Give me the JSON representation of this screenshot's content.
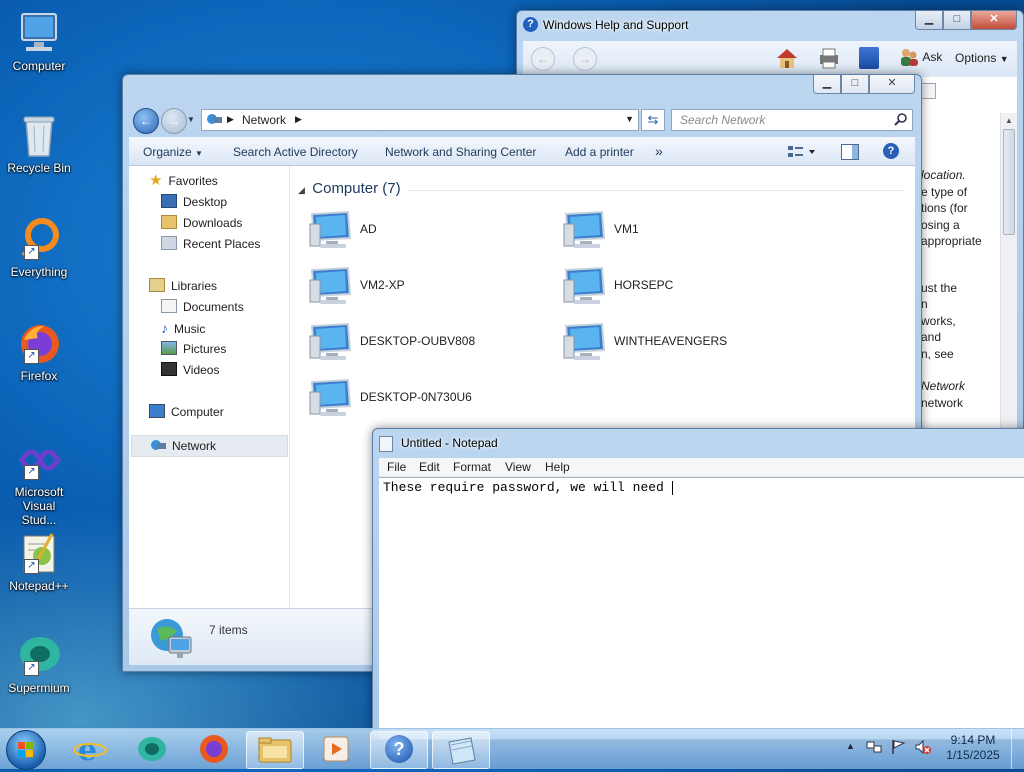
{
  "desktop": {
    "icons": [
      {
        "label": "Computer"
      },
      {
        "label": "Recycle Bin"
      },
      {
        "label": "Everything"
      },
      {
        "label": "Firefox"
      },
      {
        "label": "Microsoft Visual Stud..."
      },
      {
        "label": "Notepad++"
      },
      {
        "label": "Supermium"
      }
    ]
  },
  "help_window": {
    "title": "Windows Help and Support",
    "toolbar": {
      "ask": "Ask",
      "options": "Options"
    },
    "text_lines": [
      "location.",
      "e type of",
      "tions (for",
      "osing a",
      "appropriate",
      "ust the",
      "n",
      "works,",
      "and",
      "n, see",
      "Network",
      "network"
    ]
  },
  "explorer": {
    "address": {
      "location": "Network"
    },
    "search_placeholder": "Search Network",
    "commands": {
      "organize": "Organize",
      "search_ad": "Search Active Directory",
      "network_sharing": "Network and Sharing Center",
      "add_printer": "Add a printer",
      "more": "»"
    },
    "nav": {
      "favorites": "Favorites",
      "desktop": "Desktop",
      "downloads": "Downloads",
      "recent": "Recent Places",
      "libraries": "Libraries",
      "documents": "Documents",
      "music": "Music",
      "pictures": "Pictures",
      "videos": "Videos",
      "computer": "Computer",
      "network": "Network"
    },
    "group_header": "Computer (7)",
    "computers": [
      "AD",
      "VM1",
      "VM2-XP",
      "HORSEPC",
      "DESKTOP-OUBV808",
      "WINTHEAVENGERS",
      "DESKTOP-0N730U6"
    ],
    "status": "7 items"
  },
  "notepad": {
    "title": "Untitled - Notepad",
    "menu": {
      "file": "File",
      "edit": "Edit",
      "format": "Format",
      "view": "View",
      "help": "Help"
    },
    "text": "These require password, we will need "
  },
  "taskbar": {
    "clock": {
      "time": "9:14 PM",
      "date": "1/15/2025"
    },
    "tray_chevron": "▲"
  },
  "colors": {
    "accent": "#1e395b",
    "close_red": "#c44d3a",
    "selection": "#dbe9f9"
  }
}
